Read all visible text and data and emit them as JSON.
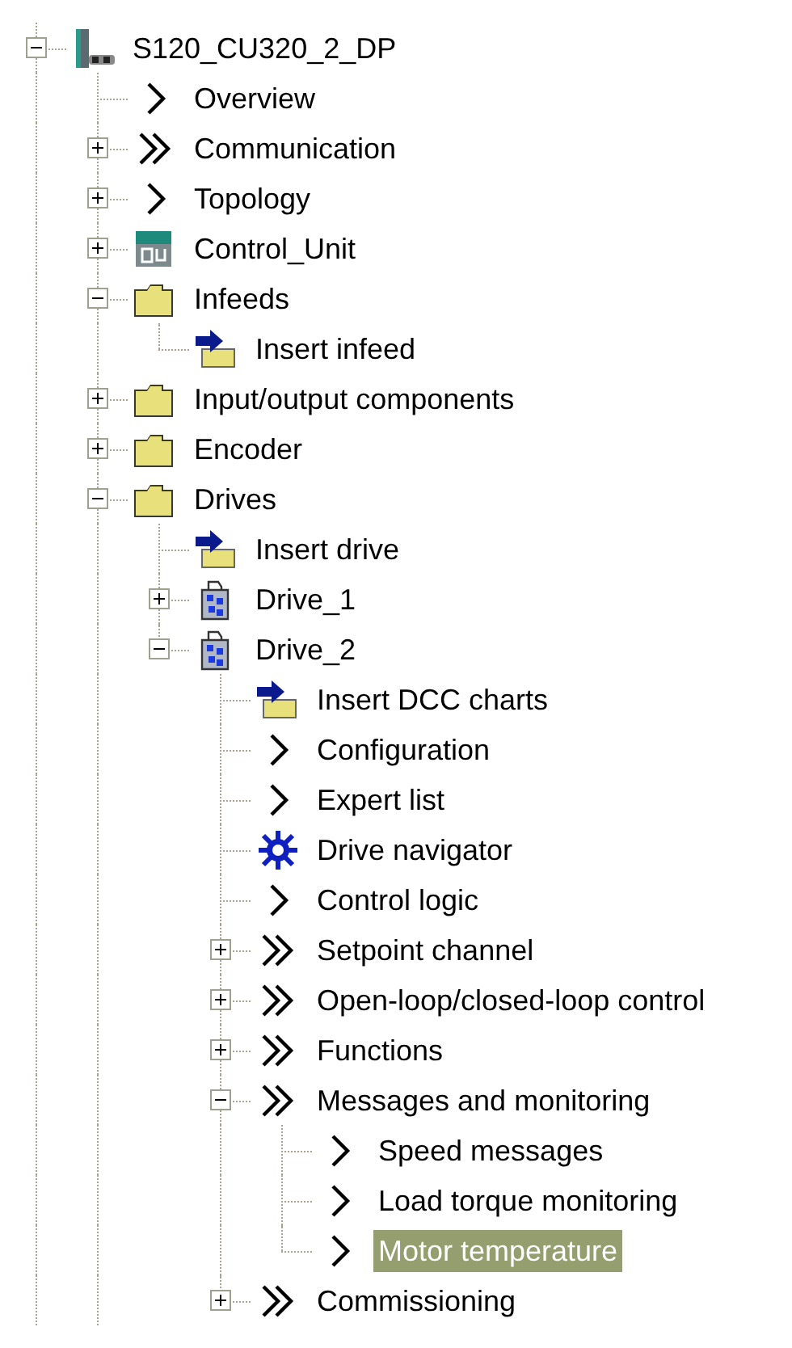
{
  "tree": [
    {
      "label": "S120_CU320_2_DP",
      "kind": "device",
      "expanded": true,
      "selected": false,
      "children": [
        {
          "label": "Overview",
          "kind": "arrow",
          "selected": false
        },
        {
          "label": "Communication",
          "kind": "double",
          "expanded": false,
          "selected": false
        },
        {
          "label": "Topology",
          "kind": "arrow",
          "expanded": false,
          "selected": false
        },
        {
          "label": "Control_Unit",
          "kind": "cu",
          "expanded": false,
          "selected": false
        },
        {
          "label": "Infeeds",
          "kind": "folder",
          "expanded": true,
          "selected": false,
          "children": [
            {
              "label": "Insert infeed",
              "kind": "insert",
              "selected": false
            }
          ]
        },
        {
          "label": "Input/output components",
          "kind": "folder",
          "expanded": false,
          "selected": false
        },
        {
          "label": "Encoder",
          "kind": "folder",
          "expanded": false,
          "selected": false
        },
        {
          "label": "Drives",
          "kind": "folder",
          "expanded": true,
          "selected": false,
          "children": [
            {
              "label": "Insert drive",
              "kind": "insert",
              "selected": false
            },
            {
              "label": "Drive_1",
              "kind": "drive",
              "expanded": false,
              "selected": false
            },
            {
              "label": "Drive_2",
              "kind": "drive",
              "expanded": true,
              "selected": false,
              "children": [
                {
                  "label": "Insert DCC charts",
                  "kind": "insert",
                  "selected": false
                },
                {
                  "label": "Configuration",
                  "kind": "arrow",
                  "selected": false
                },
                {
                  "label": "Expert list",
                  "kind": "arrow",
                  "selected": false
                },
                {
                  "label": "Drive navigator",
                  "kind": "navigator",
                  "selected": false
                },
                {
                  "label": "Control logic",
                  "kind": "arrow",
                  "selected": false
                },
                {
                  "label": "Setpoint channel",
                  "kind": "double",
                  "expanded": false,
                  "selected": false
                },
                {
                  "label": "Open-loop/closed-loop control",
                  "kind": "double",
                  "expanded": false,
                  "selected": false
                },
                {
                  "label": "Functions",
                  "kind": "double",
                  "expanded": false,
                  "selected": false
                },
                {
                  "label": "Messages and monitoring",
                  "kind": "double",
                  "expanded": true,
                  "selected": false,
                  "children": [
                    {
                      "label": "Speed messages",
                      "kind": "arrow",
                      "selected": false
                    },
                    {
                      "label": "Load torque monitoring",
                      "kind": "arrow",
                      "selected": false
                    },
                    {
                      "label": "Motor temperature",
                      "kind": "arrow",
                      "selected": true
                    }
                  ]
                },
                {
                  "label": "Commissioning",
                  "kind": "double",
                  "expanded": false,
                  "selected": false
                }
              ]
            }
          ]
        }
      ]
    }
  ]
}
